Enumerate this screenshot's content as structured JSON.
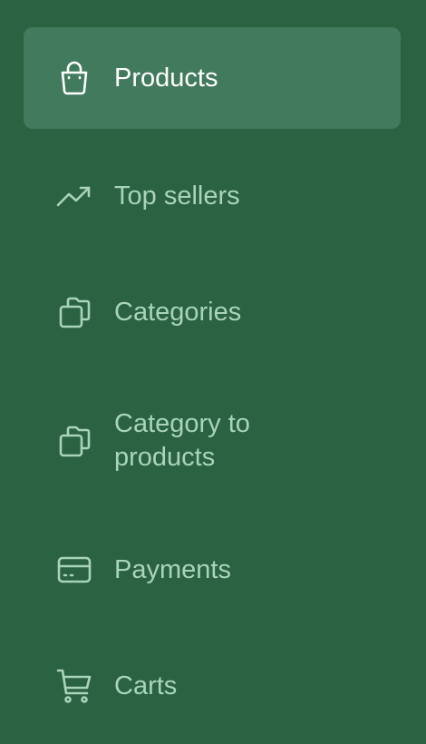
{
  "sidebar": {
    "items": [
      {
        "label": "Products",
        "icon": "shopping-bag-icon",
        "active": true
      },
      {
        "label": "Top sellers",
        "icon": "trending-up-icon",
        "active": false
      },
      {
        "label": "Categories",
        "icon": "folders-icon",
        "active": false
      },
      {
        "label": "Category to products",
        "icon": "folders-icon",
        "active": false
      },
      {
        "label": "Payments",
        "icon": "credit-card-icon",
        "active": false
      },
      {
        "label": "Carts",
        "icon": "shopping-cart-icon",
        "active": false
      }
    ]
  },
  "colors": {
    "background": "#2a6242",
    "active_background": "#427a5e",
    "inactive_text": "#a9d4b9",
    "active_text": "#ffffff"
  }
}
